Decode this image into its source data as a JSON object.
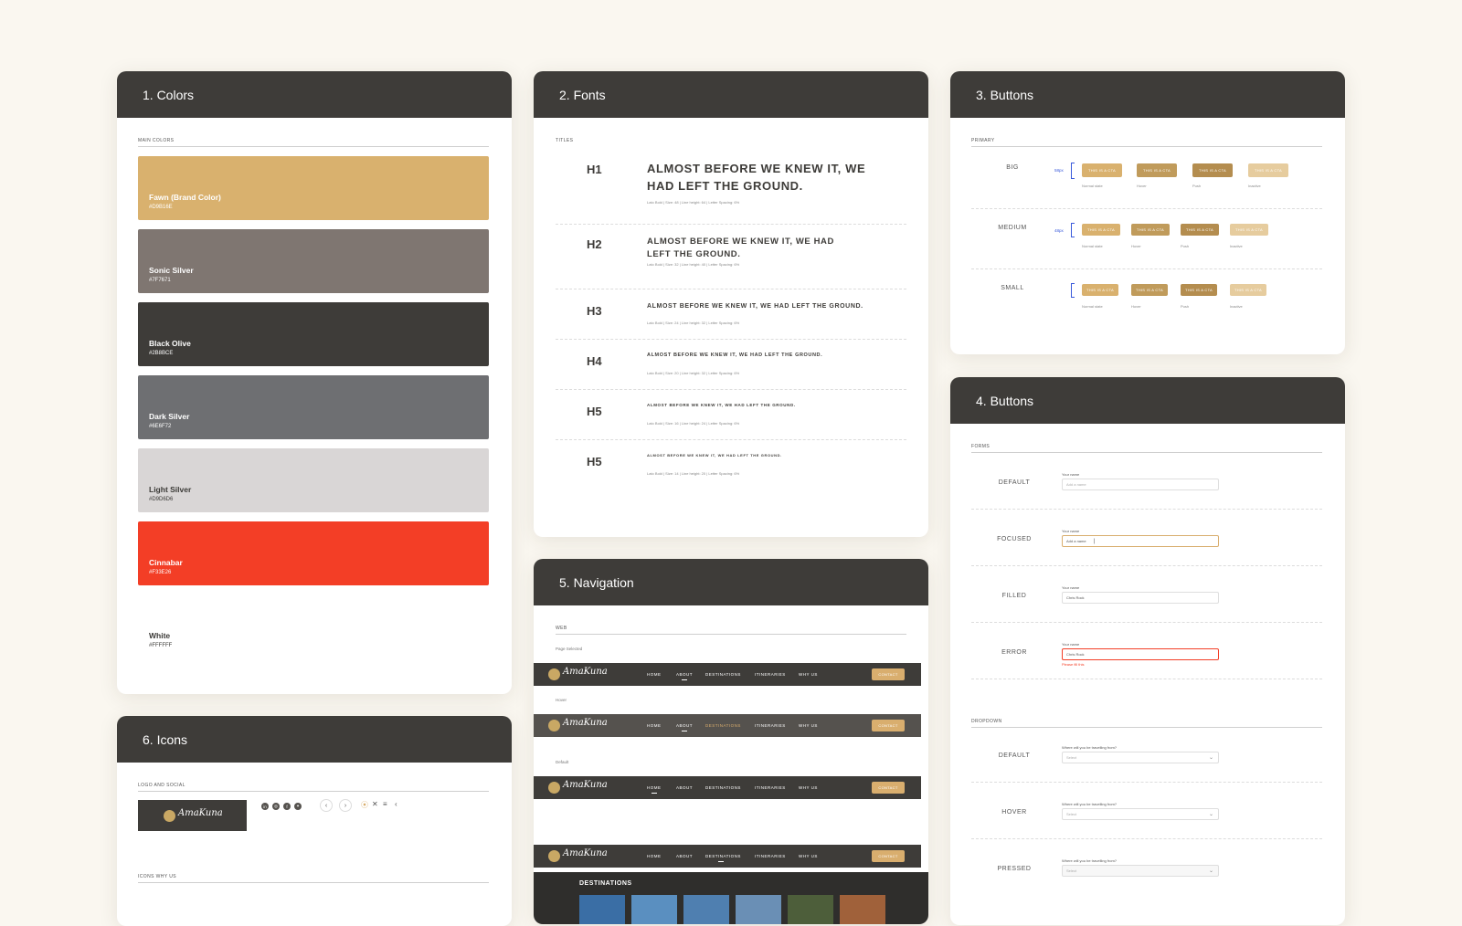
{
  "colors": {
    "title": "1. Colors",
    "section_label": "MAIN COLORS",
    "swatches": [
      {
        "name": "Fawn (Brand Color)",
        "hex": "#D9B16E",
        "color": "#D9B16E"
      },
      {
        "name": "Sonic Silver",
        "hex": "#7F7671",
        "color": "#7F7671"
      },
      {
        "name": "Black Olive",
        "hex": "#2B8BCE",
        "color": "#3E3C39"
      },
      {
        "name": "Dark Silver",
        "hex": "#6E6F72",
        "color": "#6E6F72"
      },
      {
        "name": "Light Silver",
        "hex": "#D9D6D6",
        "color": "#D9D6D6"
      },
      {
        "name": "Cinnabar",
        "hex": "#F33E26",
        "color": "#F33E26"
      },
      {
        "name": "White",
        "hex": "#FFFFFF",
        "color": "#FFFFFF"
      }
    ]
  },
  "fonts": {
    "title": "2. Fonts",
    "section_label": "TITLES",
    "rows": [
      {
        "tag": "H1",
        "sample": "ALMOST BEFORE WE KNEW IT, WE HAD LEFT THE GROUND.",
        "meta": "Lato Bold | Size: 48 | Line height: 64 | Letter Spacing: 6%"
      },
      {
        "tag": "H2",
        "sample": "ALMOST BEFORE WE KNEW IT, WE HAD LEFT THE GROUND.",
        "meta": "Lato Bold | Size: 32 | Line height: 40 | Letter Spacing: 6%"
      },
      {
        "tag": "H3",
        "sample": "ALMOST BEFORE WE KNEW IT, WE HAD LEFT THE GROUND.",
        "meta": "Lato Bold | Size: 24 | Line height: 32 | Letter Spacing: 6%"
      },
      {
        "tag": "H4",
        "sample": "ALMOST BEFORE WE KNEW IT, WE HAD LEFT THE GROUND.",
        "meta": "Lato Bold | Size: 20 | Line height: 32 | Letter Spacing: 6%"
      },
      {
        "tag": "H5",
        "sample": "ALMOST BEFORE WE KNEW IT, WE HAD LEFT THE GROUND.",
        "meta": "Lato Bold | Size: 16 | Line height: 24 | Letter Spacing: 6%"
      },
      {
        "tag": "H5",
        "sample": "ALMOST BEFORE WE KNEW IT, WE HAD LEFT THE GROUND.",
        "meta": "Lato Bold | Size: 14 | Line height: 20 | Letter Spacing: 6%"
      }
    ]
  },
  "buttons": {
    "title": "3. Buttons",
    "section_label": "PRIMARY",
    "cta_label": "THIS IS A CTA",
    "sizes": [
      {
        "label": "BIG",
        "px": "58px"
      },
      {
        "label": "MEDIUM",
        "px": "48px"
      },
      {
        "label": "SMALL",
        "px": ""
      }
    ],
    "states": [
      "Normal state",
      "Hover",
      "Push",
      "Inactive"
    ],
    "state_colors": [
      "#D9B16E",
      "#C09B5B",
      "#B48D4F",
      "#E6CC9E"
    ]
  },
  "forms": {
    "title": "4. Buttons",
    "forms_label": "FORMS",
    "dropdown_label": "DROPDOWN",
    "field_label": "Your name",
    "form_states": [
      {
        "label": "DEFAULT",
        "value": "Add a name"
      },
      {
        "label": "FOCUSED",
        "value": "Add a name"
      },
      {
        "label": "FILLED",
        "value": "Chris Rock"
      },
      {
        "label": "ERROR",
        "value": "Chris Rock",
        "error": "Please fill this"
      }
    ],
    "dropdown_question": "Where will you be travelling from?",
    "dropdown_placeholder": "Select",
    "dropdown_states": [
      "DEFAULT",
      "HOVER",
      "PRESSED"
    ],
    "error_color": "#F33E26"
  },
  "navigation": {
    "title": "5. Navigation",
    "section_label": "WEB",
    "logo_text": "AmaKuna",
    "items": [
      "HOME",
      "ABOUT",
      "DESTINATIONS",
      "ITINERARIES",
      "WHY US"
    ],
    "cta": "CONTACT",
    "states": [
      "Page Selected",
      "Hover",
      "Default"
    ],
    "dropdown_title": "DESTINATIONS"
  },
  "icons": {
    "title": "6. Icons",
    "logo_label": "LOGO AND SOCIAL",
    "why_label": "ICONS WHY US",
    "logo_text": "AmaKuna",
    "social": [
      "linkedin-icon",
      "instagram-icon",
      "facebook-icon",
      "twitter-icon"
    ]
  }
}
